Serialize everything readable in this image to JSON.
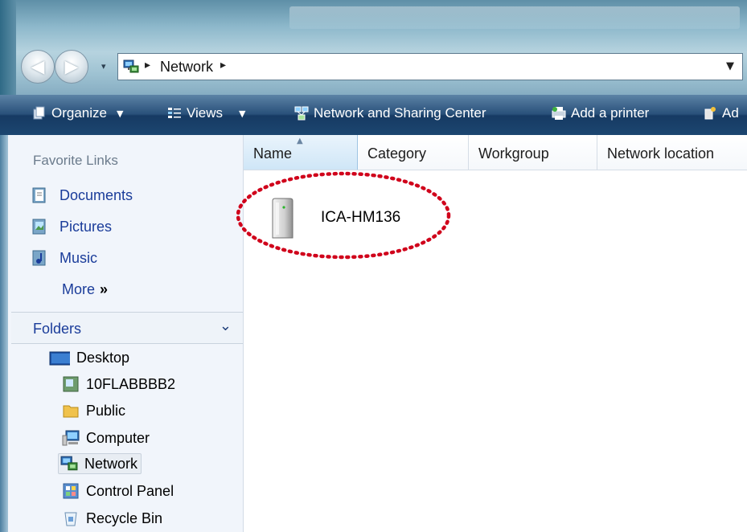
{
  "address_bar": {
    "location": "Network"
  },
  "toolbar": {
    "organize": "Organize",
    "views": "Views",
    "network_sharing_center": "Network and Sharing Center",
    "add_printer": "Add a printer",
    "add_truncated": "Ad"
  },
  "nav_pane": {
    "favorite_links_header": "Favorite Links",
    "favorites": [
      {
        "label": "Documents",
        "icon": "documents-icon"
      },
      {
        "label": "Pictures",
        "icon": "pictures-icon"
      },
      {
        "label": "Music",
        "icon": "music-icon"
      }
    ],
    "more": "More",
    "folders_header": "Folders",
    "tree": [
      {
        "label": "Desktop",
        "icon": "desktop-icon"
      },
      {
        "label": "10FLABBBB2",
        "icon": "user-folder-icon"
      },
      {
        "label": "Public",
        "icon": "folder-icon"
      },
      {
        "label": "Computer",
        "icon": "computer-icon"
      },
      {
        "label": "Network",
        "icon": "network-icon",
        "selected": true
      },
      {
        "label": "Control Panel",
        "icon": "control-panel-icon"
      },
      {
        "label": "Recycle Bin",
        "icon": "recycle-bin-icon"
      }
    ]
  },
  "content": {
    "columns": [
      "Name",
      "Category",
      "Workgroup",
      "Network location"
    ],
    "sorted_column": "Name",
    "items": [
      {
        "name": "ICA-HM136",
        "icon": "network-device-icon"
      }
    ]
  },
  "colors": {
    "toolbar_dark": "#163a63",
    "link_blue": "#1a3c9a",
    "highlight_dots": "#d0021b"
  }
}
